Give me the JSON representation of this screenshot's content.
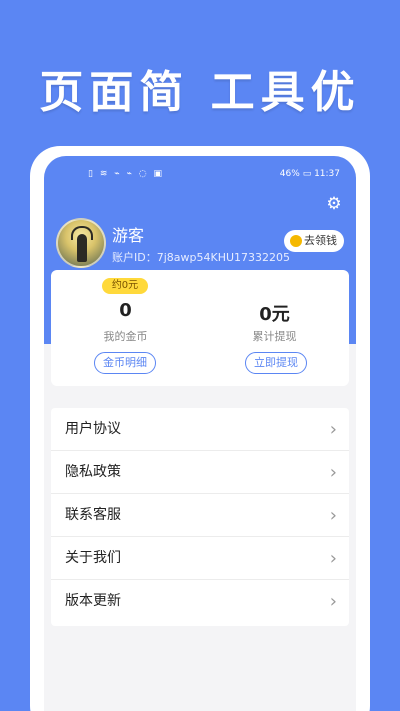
{
  "headline": "页面简 工具优",
  "status_bar": {
    "left_icons": "▯ ≋ ⌁ ⌁ ◌ ▣",
    "battery": "46%",
    "time": "11:37"
  },
  "profile": {
    "username": "游客",
    "account_id": "账户ID：7j8awp54KHU17332205",
    "claim_button": "去领钱"
  },
  "wallet": {
    "coins": {
      "approx": "约0元",
      "value": "0",
      "label": "我的金币",
      "button": "金币明细"
    },
    "withdraw": {
      "value": "0元",
      "label": "累计提现",
      "button": "立即提现"
    }
  },
  "menu": {
    "items": [
      {
        "label": "用户协议"
      },
      {
        "label": "隐私政策"
      },
      {
        "label": "联系客服"
      },
      {
        "label": "关于我们"
      },
      {
        "label": "版本更新"
      }
    ]
  },
  "icons": {
    "settings": "gear-icon",
    "chevron": "chevron-right-icon",
    "coin": "coin-icon"
  },
  "colors": {
    "accent": "#5b86f3",
    "badge": "#ffd93b"
  }
}
